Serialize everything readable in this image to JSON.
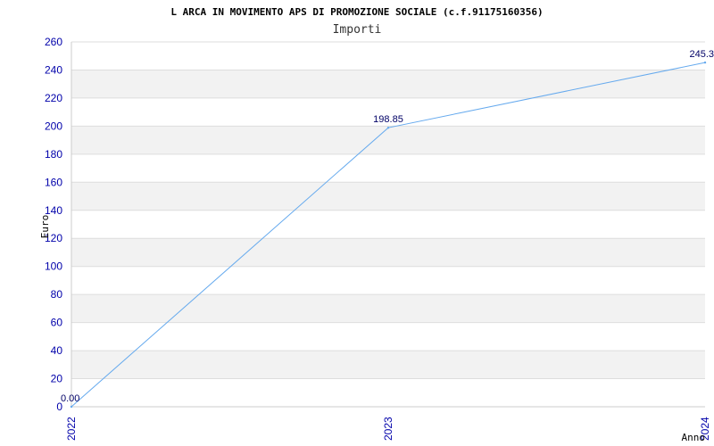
{
  "chart_data": {
    "type": "line",
    "title": "L ARCA IN MOVIMENTO APS DI PROMOZIONE SOCIALE (c.f.91175160356)",
    "subtitle": "Importi",
    "xlabel": "Anno",
    "ylabel": "Euro",
    "categories": [
      "2022",
      "2023",
      "2024"
    ],
    "series": [
      {
        "values": [
          0,
          198.85,
          245.3
        ],
        "labels": [
          "0.00",
          "198.85",
          "245.3"
        ]
      }
    ],
    "ylim": [
      0,
      260
    ],
    "yticks": [
      "0",
      "20",
      "40",
      "60",
      "80",
      "100",
      "120",
      "140",
      "160",
      "180",
      "200",
      "220",
      "240",
      "260"
    ],
    "grid": true,
    "colors": {
      "line": "#66aaee",
      "band": "#f2f2f2",
      "tick": "#0000aa",
      "grid": "#dddddd"
    }
  }
}
